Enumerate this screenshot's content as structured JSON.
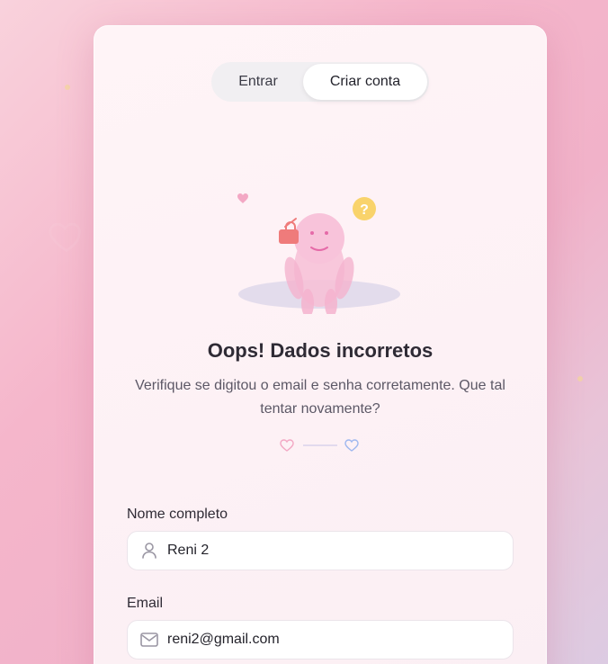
{
  "tabs": {
    "login_label": "Entrar",
    "signup_label": "Criar conta",
    "active": "signup"
  },
  "illustration": {
    "icons": [
      "heart-icon",
      "question-mark-icon",
      "padlock-icon"
    ],
    "badge_text": "?"
  },
  "error": {
    "title": "Oops! Dados incorretos",
    "message": "Verifique se digitou o email e senha corretamente. Que tal tentar novamente?"
  },
  "form": {
    "name_label": "Nome completo",
    "name_value": "Reni 2",
    "email_label": "Email",
    "email_value": "reni2@gmail.com"
  },
  "colors": {
    "heart_pink": "#f3a8c4",
    "heart_blue": "#9fb8ef",
    "badge_yellow": "#f9d36b",
    "lock_red": "#ef7b7b",
    "character_pink": "#f7bfd6"
  }
}
